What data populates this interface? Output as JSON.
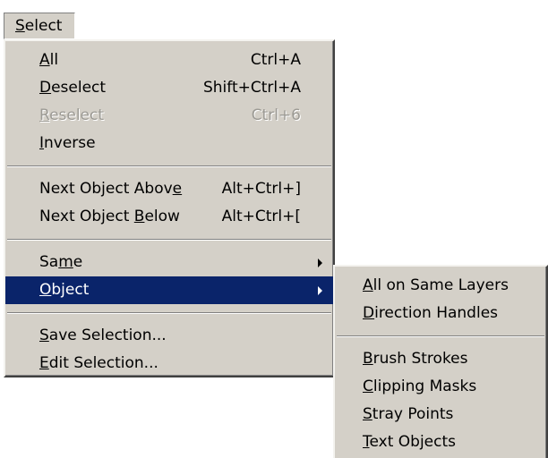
{
  "menubar": {
    "select_label": "Select"
  },
  "select_menu": {
    "all": {
      "label": "All",
      "shortcut": "Ctrl+A"
    },
    "deselect": {
      "label": "Deselect",
      "shortcut": "Shift+Ctrl+A"
    },
    "reselect": {
      "label": "Reselect",
      "shortcut": "Ctrl+6"
    },
    "inverse": {
      "label": "Inverse"
    },
    "next_object_above": {
      "label": "Next Object Above",
      "shortcut": "Alt+Ctrl+]"
    },
    "next_object_below": {
      "label": "Next Object Below",
      "shortcut": "Alt+Ctrl+["
    },
    "same": {
      "label": "Same"
    },
    "object": {
      "label": "Object"
    },
    "save_selection": {
      "label": "Save Selection..."
    },
    "edit_selection": {
      "label": "Edit Selection..."
    }
  },
  "object_submenu": {
    "all_on_same_layers": "All on Same Layers",
    "direction_handles": "Direction Handles",
    "brush_strokes": "Brush Strokes",
    "clipping_masks": "Clipping Masks",
    "stray_points": "Stray Points",
    "text_objects": "Text Objects"
  },
  "icons": {
    "submenu_arrow": "chevron-right-icon"
  },
  "colors": {
    "menu_background": "#d4d0c8",
    "highlight": "#0a246a",
    "disabled_text": "#9c9a94"
  }
}
